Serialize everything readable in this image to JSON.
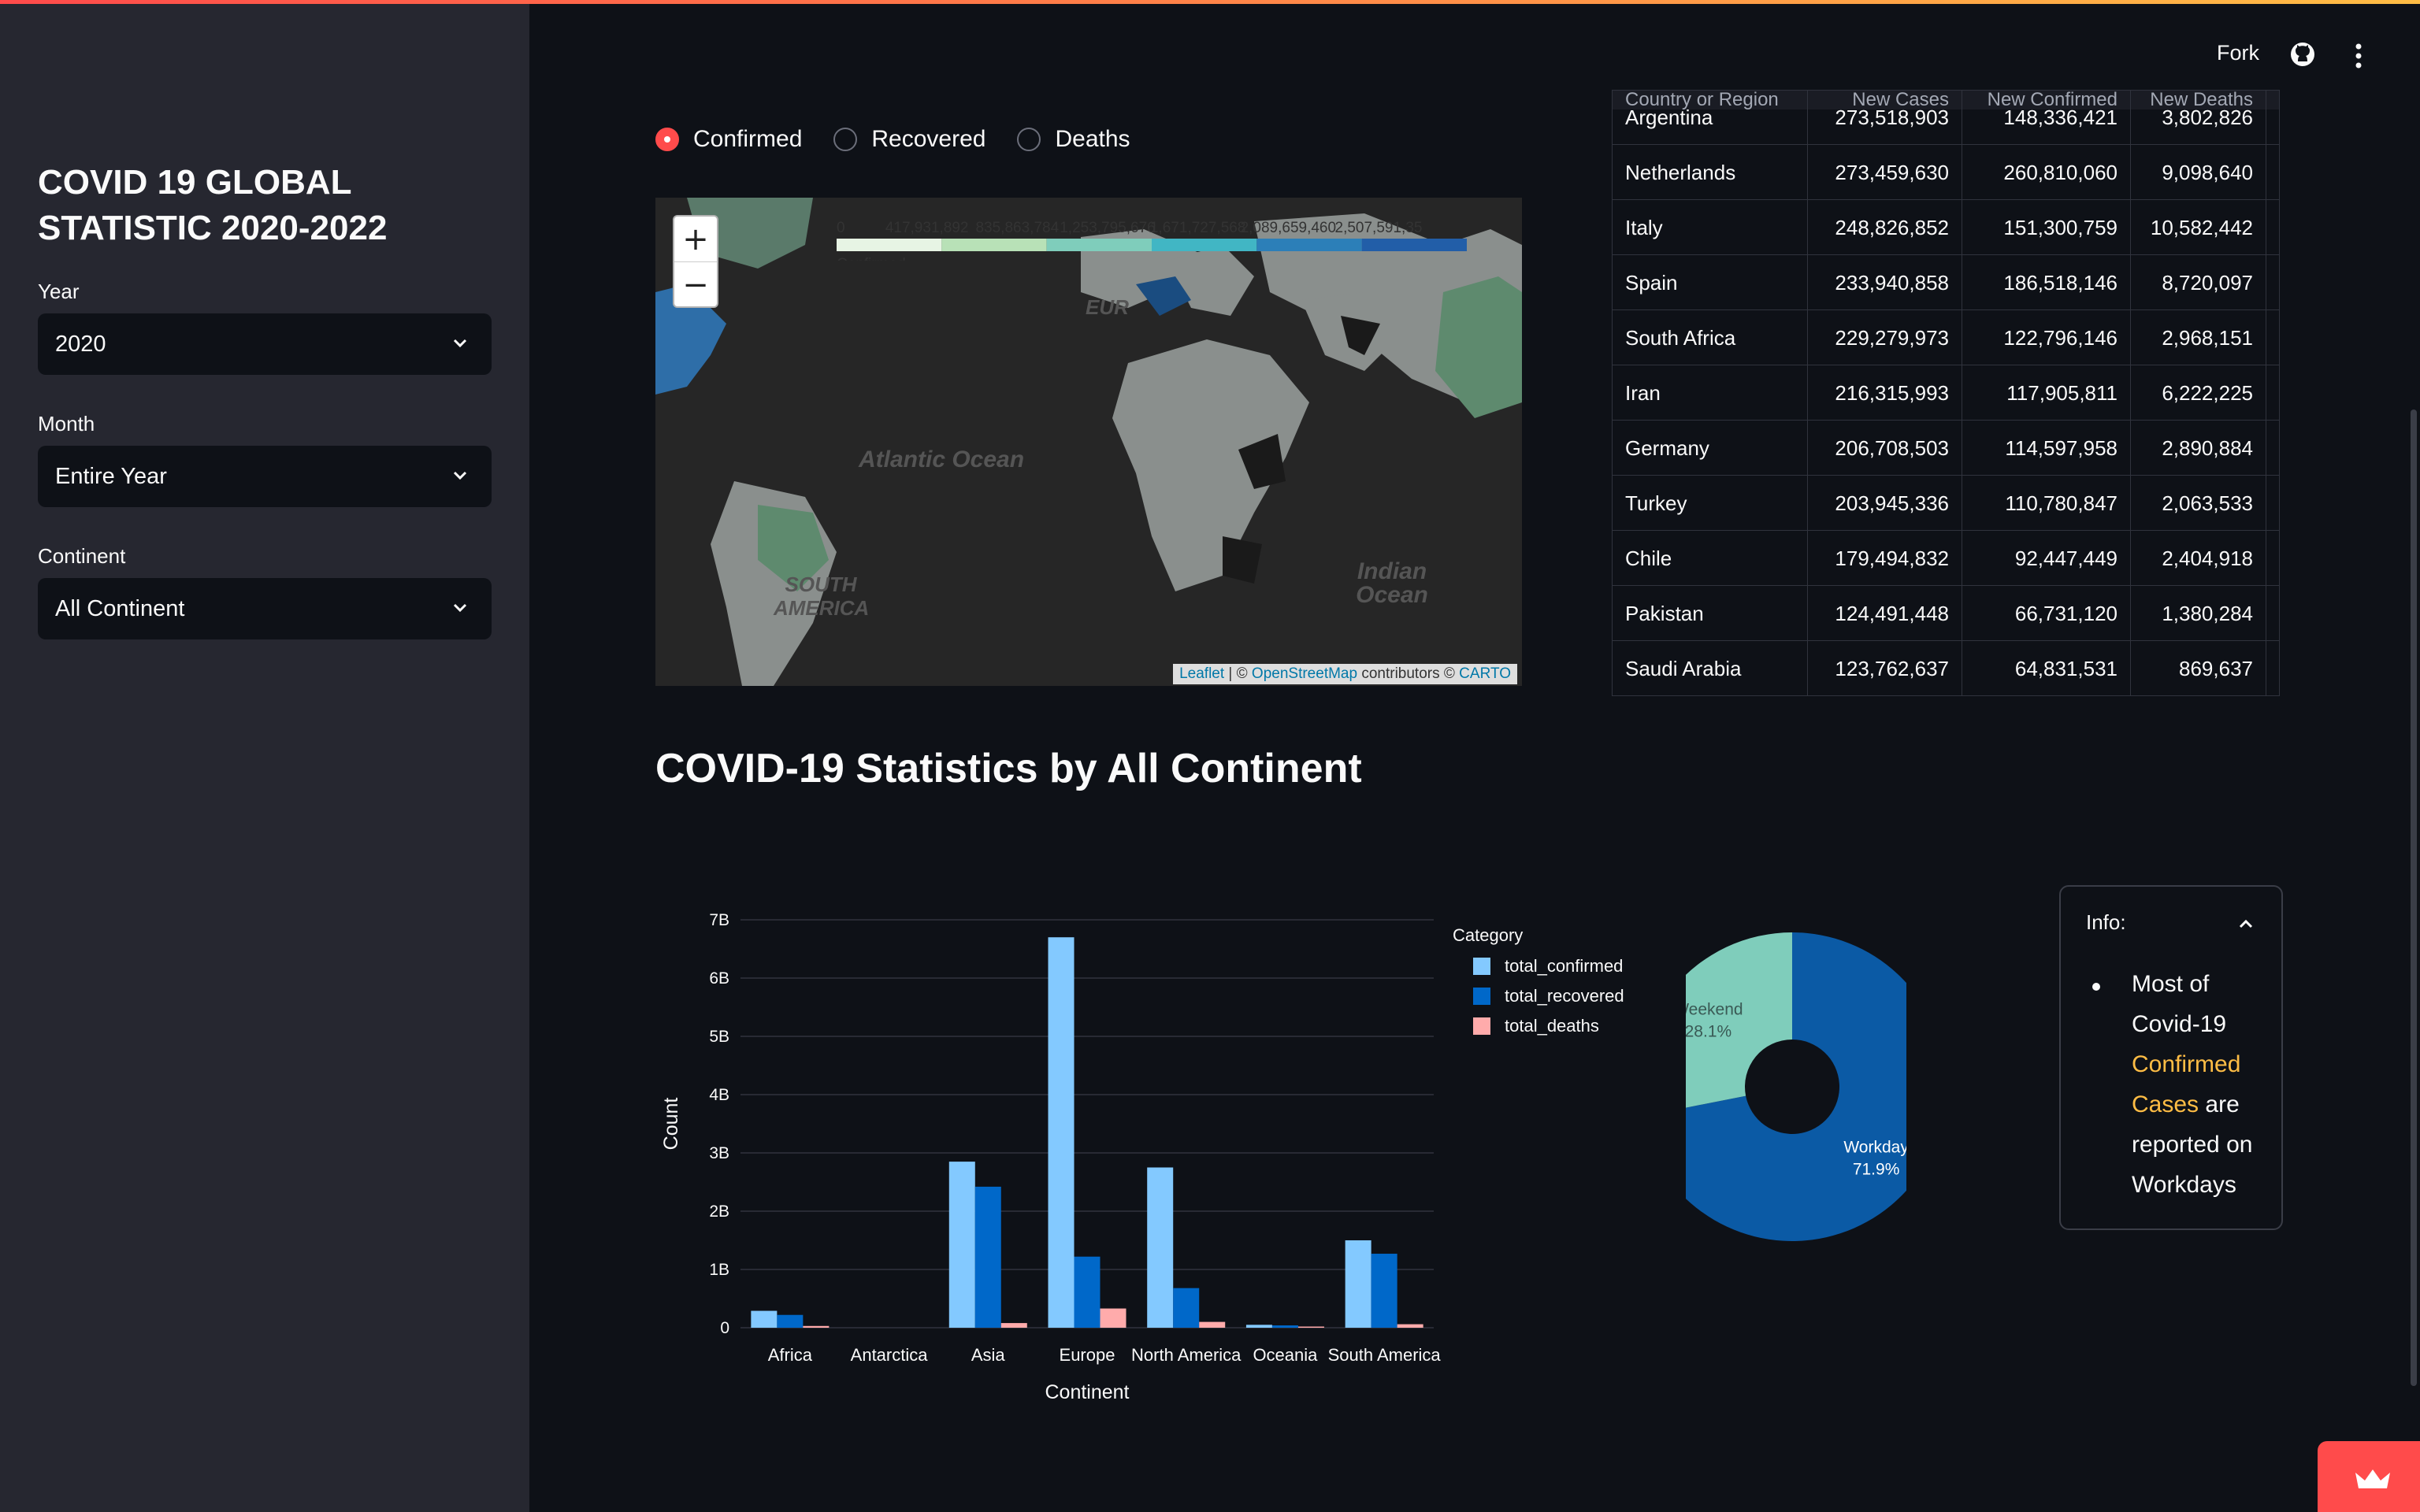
{
  "sidebar": {
    "title": "COVID 19 GLOBAL STATISTIC 2020-2022",
    "year_label": "Year",
    "year_value": "2020",
    "month_label": "Month",
    "month_value": "Entire Year",
    "continent_label": "Continent",
    "continent_value": "All Continent"
  },
  "header": {
    "fork": "Fork"
  },
  "radio": {
    "options": [
      "Confirmed",
      "Recovered",
      "Deaths"
    ],
    "selected": "Confirmed"
  },
  "map": {
    "legend_ticks": [
      "0",
      "417,931,892",
      "835,863,784",
      "1,253,795,676",
      "1,671,727,568",
      "2,089,659,460",
      "2,507,591,35"
    ],
    "legend_title": "Confirmed",
    "legend_colors": [
      "#e7f4e4",
      "#b8e1b7",
      "#7fcdbb",
      "#41b6c4",
      "#2c7fb8",
      "#225ea8"
    ],
    "labels": {
      "atlantic": "Atlantic Ocean",
      "indian": "Indian Ocean",
      "south_america": "SOUTH AMERICA",
      "europe": "EUR"
    },
    "attribution": {
      "leaflet": "Leaflet",
      "sep": " | © ",
      "osm": "OpenStreetMap",
      "contrib": " contributors © ",
      "carto": "CARTO"
    }
  },
  "table": {
    "headers": [
      "Country or Region",
      "New Cases",
      "New Confirmed",
      "New Deaths"
    ],
    "rows": [
      [
        "Argentina",
        "273,518,903",
        "148,336,421",
        "3,802,826"
      ],
      [
        "Netherlands",
        "273,459,630",
        "260,810,060",
        "9,098,640"
      ],
      [
        "Italy",
        "248,826,852",
        "151,300,759",
        "10,582,442"
      ],
      [
        "Spain",
        "233,940,858",
        "186,518,146",
        "8,720,097"
      ],
      [
        "South Africa",
        "229,279,973",
        "122,796,146",
        "2,968,151"
      ],
      [
        "Iran",
        "216,315,993",
        "117,905,811",
        "6,222,225"
      ],
      [
        "Germany",
        "206,708,503",
        "114,597,958",
        "2,890,884"
      ],
      [
        "Turkey",
        "203,945,336",
        "110,780,847",
        "2,063,533"
      ],
      [
        "Chile",
        "179,494,832",
        "92,447,449",
        "2,404,918"
      ],
      [
        "Pakistan",
        "124,491,448",
        "66,731,120",
        "1,380,284"
      ],
      [
        "Saudi Arabia",
        "123,762,637",
        "64,831,531",
        "869,637"
      ]
    ]
  },
  "section_title": "COVID-19 Statistics by All Continent",
  "chart_data": [
    {
      "type": "bar",
      "categories": [
        "Africa",
        "Antarctica",
        "Asia",
        "Europe",
        "North America",
        "Oceania",
        "South America"
      ],
      "series": [
        {
          "name": "total_confirmed",
          "color": "#83c9ff",
          "values": [
            0.29,
            0.0,
            2.85,
            6.7,
            2.75,
            0.05,
            1.5
          ]
        },
        {
          "name": "total_recovered",
          "color": "#0068c9",
          "values": [
            0.22,
            0.0,
            2.42,
            1.22,
            0.68,
            0.04,
            1.27
          ]
        },
        {
          "name": "total_deaths",
          "color": "#ffabab",
          "values": [
            0.03,
            0.0,
            0.08,
            0.33,
            0.1,
            0.02,
            0.06
          ]
        }
      ],
      "value_unit": "billions",
      "xlabel": "Continent",
      "ylabel": "Count",
      "yticks": [
        "0",
        "1B",
        "2B",
        "3B",
        "4B",
        "5B",
        "6B",
        "7B"
      ],
      "ylim": [
        0,
        7
      ],
      "legend_title": "Category",
      "legend_position": "right",
      "grid": true
    },
    {
      "type": "pie",
      "hole": true,
      "slices": [
        {
          "label": "Weekend",
          "percent": "28.1%",
          "value": 28.1,
          "color": "#7fcdbb",
          "text_color": "#3a5a55"
        },
        {
          "label": "Workday",
          "percent": "71.9%",
          "value": 71.9,
          "color": "#0b5aa5",
          "text_color": "#ffffff"
        }
      ]
    }
  ],
  "info": {
    "title": "Info:",
    "text_pre": "Most of Covid-19",
    "highlight": "Confirmed Cases",
    "text_post": "are reported on Workdays"
  }
}
